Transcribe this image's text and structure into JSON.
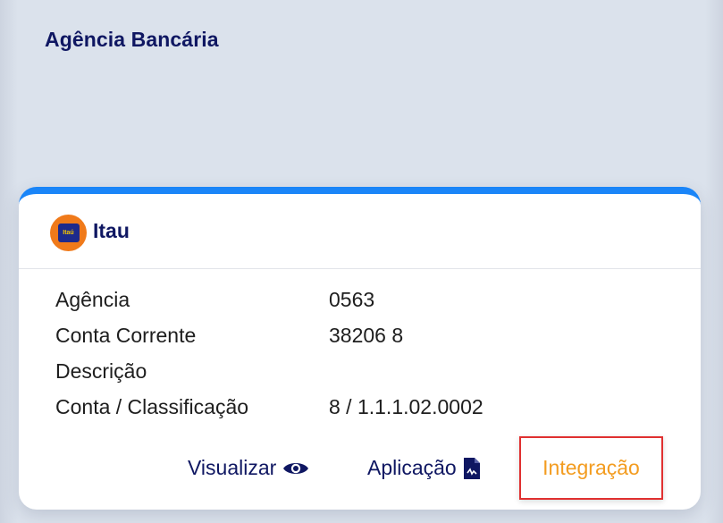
{
  "page": {
    "title": "Agência Bancária"
  },
  "card": {
    "bank_name": "Itau",
    "logo_text": "Itaú",
    "accent_color": "#1a85f8",
    "rows": [
      {
        "label": "Agência",
        "value": "0563"
      },
      {
        "label": "Conta Corrente",
        "value": "38206 8"
      },
      {
        "label": "Descrição",
        "value": ""
      },
      {
        "label": "Conta / Classificação",
        "value": "8 / 1.1.1.02.0002"
      }
    ],
    "actions": {
      "view_label": "Visualizar",
      "view_icon": "eye-icon",
      "application_label": "Aplicação",
      "application_icon": "document-icon",
      "integration_label": "Integração",
      "integration_color": "#f39c20"
    }
  }
}
